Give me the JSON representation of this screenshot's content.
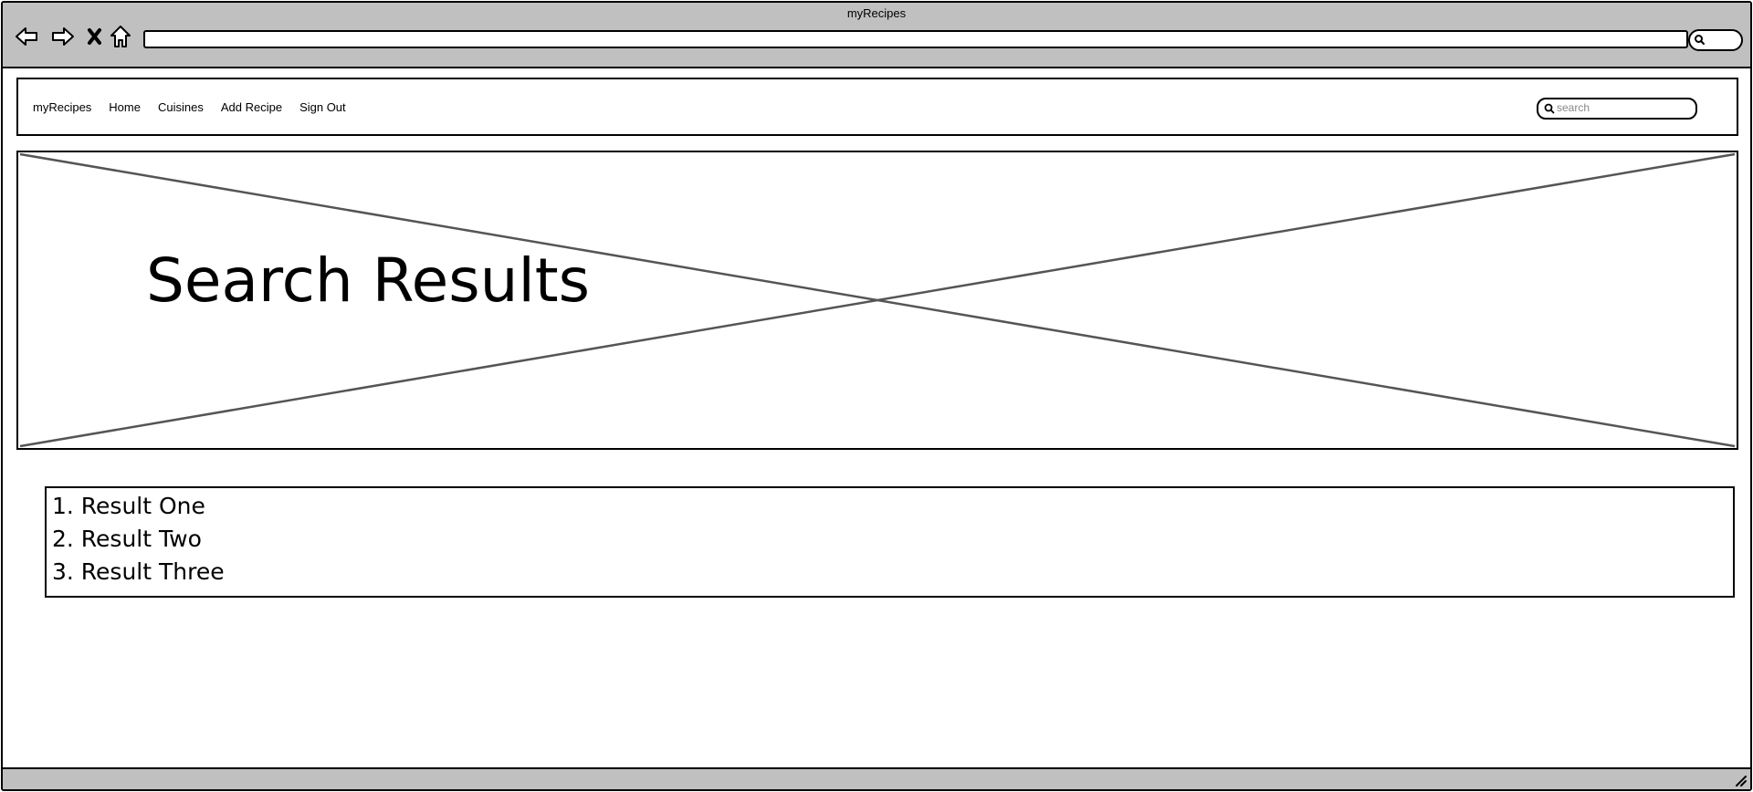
{
  "window": {
    "title": "myRecipes",
    "address": ""
  },
  "toolbar": {
    "back_icon": "arrow-left-icon",
    "forward_icon": "arrow-right-icon",
    "stop_icon": "close-icon",
    "home_icon": "home-icon",
    "search_icon": "search-icon"
  },
  "navbar": {
    "brand": "myRecipes",
    "links": [
      "Home",
      "Cuisines",
      "Add Recipe",
      "Sign Out"
    ],
    "search": {
      "placeholder": "search",
      "value": ""
    }
  },
  "hero": {
    "title": "Search Results",
    "image_icon": "image-placeholder"
  },
  "results": [
    "1. Result One",
    "2. Result Two",
    "3. Result Three"
  ],
  "colors": {
    "chrome": "#c0c0c0",
    "line": "#000000",
    "placeholder_x": "#555555"
  }
}
